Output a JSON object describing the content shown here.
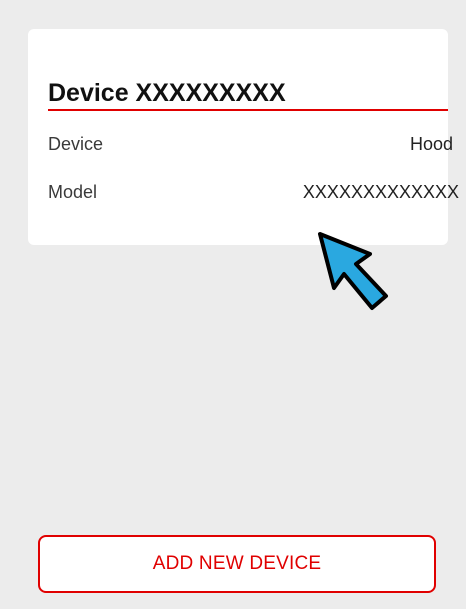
{
  "card": {
    "title": "Device XXXXXXXXX",
    "rows": [
      {
        "label": "Device",
        "value": "Hood"
      },
      {
        "label": "Model",
        "value": "XXXXXXXXXXXXX"
      }
    ]
  },
  "actions": {
    "add_device_label": "ADD NEW DEVICE"
  },
  "colors": {
    "accent": "#e00000",
    "background": "#ececec",
    "card": "#ffffff",
    "arrow_fill": "#2aa8e0"
  },
  "icons": {
    "pointer": "arrow-pointer-icon"
  }
}
